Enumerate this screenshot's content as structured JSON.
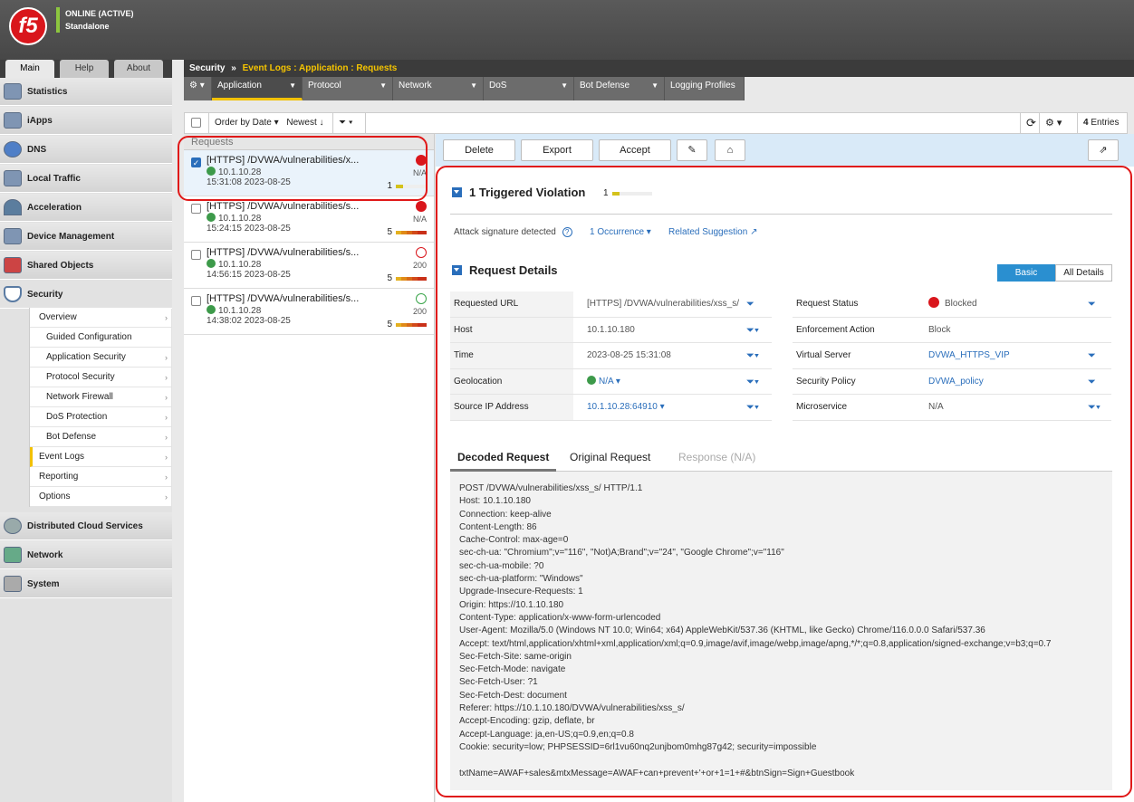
{
  "header": {
    "logo_text": "f5",
    "status": "ONLINE (ACTIVE)",
    "mode": "Standalone"
  },
  "nav_tabs": [
    "Main",
    "Help",
    "About"
  ],
  "sidebar": {
    "items": [
      {
        "label": "Statistics",
        "icon": "statistics-icon"
      },
      {
        "label": "iApps",
        "icon": "iapps-icon"
      },
      {
        "label": "DNS",
        "icon": "dns-globe-icon"
      },
      {
        "label": "Local Traffic",
        "icon": "local-traffic-icon"
      },
      {
        "label": "Acceleration",
        "icon": "acceleration-gauge-icon"
      },
      {
        "label": "Device Management",
        "icon": "device-management-icon"
      },
      {
        "label": "Shared Objects",
        "icon": "shared-objects-icon"
      },
      {
        "label": "Security",
        "icon": "security-shield-icon"
      }
    ],
    "security_submenu": [
      "Overview",
      "Guided Configuration",
      "Application Security",
      "Protocol Security",
      "Network Firewall",
      "DoS Protection",
      "Bot Defense",
      "Event Logs",
      "Reporting",
      "Options"
    ],
    "bottom_items": [
      {
        "label": "Distributed Cloud Services",
        "icon": "cloud-icon"
      },
      {
        "label": "Network",
        "icon": "network-icon"
      },
      {
        "label": "System",
        "icon": "system-icon"
      }
    ]
  },
  "breadcrumb": {
    "root": "Security",
    "sep": "»",
    "path": "Event Logs : Application : Requests"
  },
  "tabs": {
    "gear": "⚙ ▾",
    "items": [
      "Application",
      "Protocol",
      "Network",
      "DoS",
      "Bot Defense",
      "Logging Profiles"
    ]
  },
  "toolbar": {
    "order": "Order by Date ▾",
    "newest": "Newest ↓",
    "filter": "⏷ ▾",
    "refresh": "⟳",
    "settings": "⚙ ▾",
    "entries_count": "4",
    "entries_label": "Entries"
  },
  "requests": {
    "header": "Requests",
    "rows": [
      {
        "url": "[HTTPS] /DVWA/vulnerabilities/x...",
        "ip": "10.1.10.28",
        "time": "15:31:08 2023-08-25",
        "code": "N/A",
        "count": "1"
      },
      {
        "url": "[HTTPS] /DVWA/vulnerabilities/s...",
        "ip": "10.1.10.28",
        "time": "15:24:15 2023-08-25",
        "code": "N/A",
        "count": "5"
      },
      {
        "url": "[HTTPS] /DVWA/vulnerabilities/s...",
        "ip": "10.1.10.28",
        "time": "14:56:15 2023-08-25",
        "code": "200",
        "count": "5"
      },
      {
        "url": "[HTTPS] /DVWA/vulnerabilities/s...",
        "ip": "10.1.10.28",
        "time": "14:38:02 2023-08-25",
        "code": "200",
        "count": "5"
      }
    ]
  },
  "actions": {
    "delete": "Delete",
    "export": "Export",
    "accept": "Accept",
    "comment": "✎",
    "tag": "⌂",
    "popout": "⇗"
  },
  "violation": {
    "title": "1 Triggered Violation",
    "count": "1",
    "text": "Attack signature detected",
    "help": "?",
    "occurrence": "1 Occurrence ▾",
    "related": "Related Suggestion ↗"
  },
  "details": {
    "title": "Request Details",
    "toggle_basic": "Basic",
    "toggle_all": "All Details",
    "left": [
      {
        "k": "Requested URL",
        "v": "[HTTPS] /DVWA/vulnerabilities/xss_s/",
        "f": "⏷"
      },
      {
        "k": "Host",
        "v": "10.1.10.180",
        "f": "⏷▾"
      },
      {
        "k": "Time",
        "v": "2023-08-25 15:31:08",
        "f": "⏷▾"
      },
      {
        "k": "Geolocation",
        "v": "N/A ▾",
        "f": "⏷▾"
      },
      {
        "k": "Source IP Address",
        "v": "10.1.10.28:64910 ▾",
        "f": "⏷▾"
      }
    ],
    "right": [
      {
        "k": "Request Status",
        "v": "Blocked",
        "f": "⏷"
      },
      {
        "k": "Enforcement Action",
        "v": "Block",
        "f": ""
      },
      {
        "k": "Virtual Server",
        "v": "DVWA_HTTPS_VIP",
        "f": "⏷"
      },
      {
        "k": "Security Policy",
        "v": "DVWA_policy",
        "f": "⏷"
      },
      {
        "k": "Microservice",
        "v": "N/A",
        "f": "⏷▾"
      }
    ]
  },
  "view_tabs": [
    "Decoded Request",
    "Original Request",
    "Response (N/A)"
  ],
  "request_body": "POST /DVWA/vulnerabilities/xss_s/ HTTP/1.1\nHost: 10.1.10.180\nConnection: keep-alive\nContent-Length: 86\nCache-Control: max-age=0\nsec-ch-ua: \"Chromium\";v=\"116\", \"Not)A;Brand\";v=\"24\", \"Google Chrome\";v=\"116\"\nsec-ch-ua-mobile: ?0\nsec-ch-ua-platform: \"Windows\"\nUpgrade-Insecure-Requests: 1\nOrigin: https://10.1.10.180\nContent-Type: application/x-www-form-urlencoded\nUser-Agent: Mozilla/5.0 (Windows NT 10.0; Win64; x64) AppleWebKit/537.36 (KHTML, like Gecko) Chrome/116.0.0.0 Safari/537.36\nAccept: text/html,application/xhtml+xml,application/xml;q=0.9,image/avif,image/webp,image/apng,*/*;q=0.8,application/signed-exchange;v=b3;q=0.7\nSec-Fetch-Site: same-origin\nSec-Fetch-Mode: navigate\nSec-Fetch-User: ?1\nSec-Fetch-Dest: document\nReferer: https://10.1.10.180/DVWA/vulnerabilities/xss_s/\nAccept-Encoding: gzip, deflate, br\nAccept-Language: ja,en-US;q=0.9,en;q=0.8\nCookie: security=low; PHPSESSID=6rl1vu60nq2unjbom0mhg87g42; security=impossible\n\ntxtName=AWAF+sales&mtxMessage=AWAF+can+prevent+'+or+1=1+#&btnSign=Sign+Guestbook",
  "colors": {
    "accent": "#2a6ebb",
    "highlight": "#f2c100",
    "blocked": "#d9161c",
    "annotation": "#e01818"
  }
}
